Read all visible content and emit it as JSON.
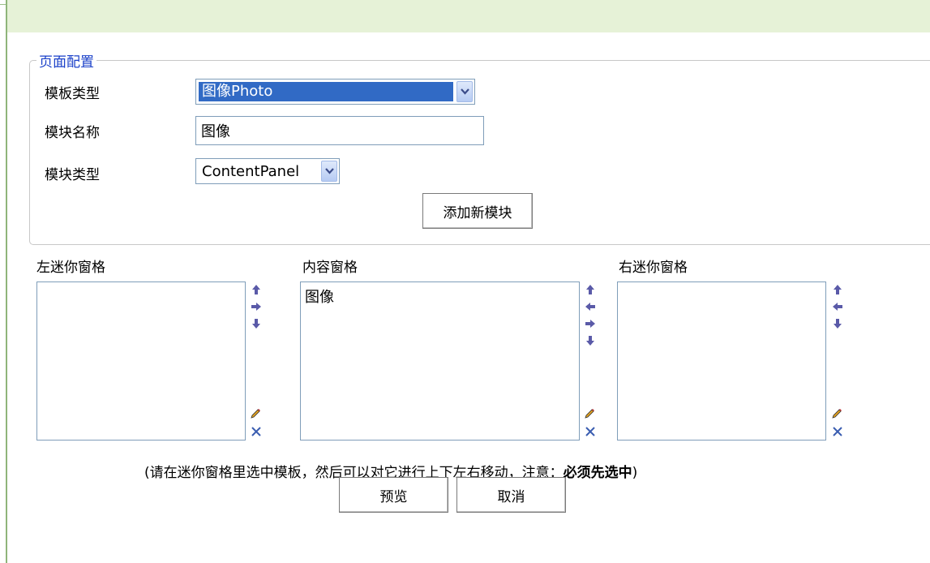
{
  "config": {
    "legend": "页面配置",
    "template_type_label": "模板类型",
    "template_type_value": "图像Photo",
    "module_name_label": "模块名称",
    "module_name_value": "图像",
    "module_type_label": "模块类型",
    "module_type_value": "ContentPanel",
    "add_button": "添加新模块"
  },
  "panes": {
    "left": {
      "title": "左迷你窗格",
      "items": []
    },
    "content": {
      "title": "内容窗格",
      "items": [
        "图像"
      ]
    },
    "right": {
      "title": "右迷你窗格",
      "items": []
    }
  },
  "hint": {
    "prefix": "(请在迷你窗格里选中模板，然后可以对它进行上下左右移动，注意：",
    "emphasis": "必须先选中",
    "suffix": ")"
  },
  "actions": {
    "preview": "预览",
    "cancel": "取消"
  },
  "icons": {
    "arrow_color": "#5a5aa8",
    "edit": "pencil-icon",
    "delete": "delete-x-icon"
  }
}
